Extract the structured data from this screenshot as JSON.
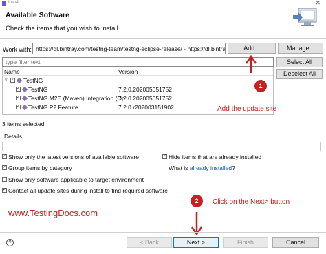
{
  "window": {
    "title": "Install"
  },
  "header": {
    "title": "Available Software",
    "description": "Check the items that you wish to install."
  },
  "work_with": {
    "label": "Work with:",
    "value": "https://dl.bintray.com/testng-team/testng-eclipse-release/ - https://dl.bintra",
    "add_label": "Add...",
    "manage_label": "Manage..."
  },
  "filter": {
    "placeholder": "type filter text"
  },
  "side_buttons": {
    "select_all": "Select All",
    "deselect_all": "Deselect All"
  },
  "tree": {
    "columns": [
      "Name",
      "Version"
    ],
    "group": {
      "name": "TestNG",
      "checked": true
    },
    "items": [
      {
        "name": "TestNG",
        "version": "7.2.0.202005051752",
        "checked": true
      },
      {
        "name": "TestNG M2E (Maven) Integration (Op",
        "version": "7.2.0.202005051752",
        "checked": true
      },
      {
        "name": "TestNG P2 Feature",
        "version": "7.2.0.r202003151902",
        "checked": true
      }
    ]
  },
  "status": "3 items selected",
  "details": {
    "label": "Details"
  },
  "options": {
    "latest_only": {
      "label": "Show only the latest versions of available software",
      "checked": true
    },
    "hide_installed": {
      "label": "Hide items that are already installed",
      "checked": true
    },
    "group_by_category": {
      "label": "Group items by category",
      "checked": true
    },
    "what_is": "What is",
    "already_installed_link": "already installed",
    "what_is_suffix": "?",
    "target_env": {
      "label": "Show only software applicable to target environment",
      "checked": false
    },
    "contact_sites": {
      "label": "Contact all update sites during install to find required software",
      "checked": true
    }
  },
  "annotations": {
    "step1": "1",
    "step1_text": "Add the update site",
    "step2": "2",
    "step2_text": "Click on the Next> button",
    "watermark": "www.TestingDocs.com",
    "color": "#c62020"
  },
  "footer": {
    "help": "?",
    "back": "< Back",
    "next": "Next >",
    "finish": "Finish",
    "cancel": "Cancel"
  }
}
